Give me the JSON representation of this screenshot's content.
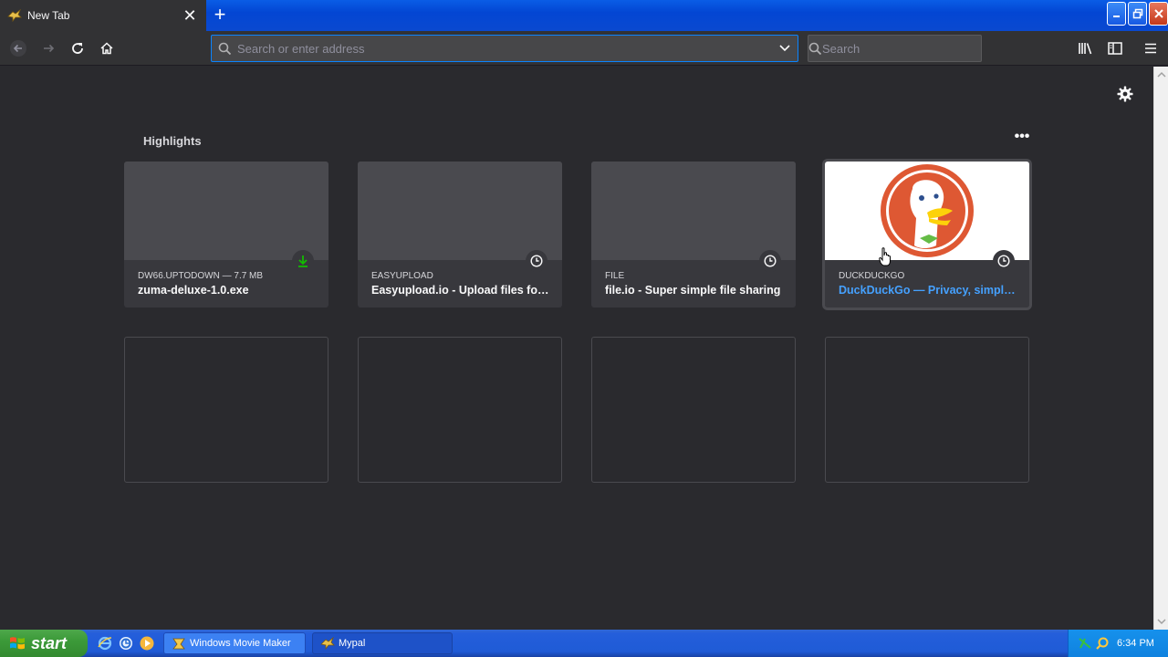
{
  "window": {
    "tab_title": "New Tab",
    "tab_close": "✕",
    "new_tab": "+"
  },
  "toolbar": {
    "url_placeholder": "Search or enter address",
    "search_placeholder": "Search"
  },
  "highlights": {
    "title": "Highlights",
    "more": "•••",
    "cards": [
      {
        "meta": "DW66.UPTODOWN — 7.7 MB",
        "title": "zuma-deluxe-1.0.exe",
        "badge": "download-icon"
      },
      {
        "meta": "EASYUPLOAD",
        "title": "Easyupload.io - Upload files for f...",
        "badge": "clock-icon"
      },
      {
        "meta": "FILE",
        "title": "file.io - Super simple file sharing",
        "badge": "clock-icon"
      },
      {
        "meta": "DUCKDUCKGO",
        "title": "DuckDuckGo — Privacy, simplifi...",
        "badge": "clock-icon"
      }
    ]
  },
  "taskbar": {
    "start_label": "start",
    "tasks": [
      "Windows Movie Maker",
      "Mypal"
    ],
    "clock": "6:34 PM"
  },
  "colors": {
    "accent": "#0a84ff",
    "link": "#45a1ff",
    "download": "#12bc00",
    "background": "#2a2a2e"
  }
}
